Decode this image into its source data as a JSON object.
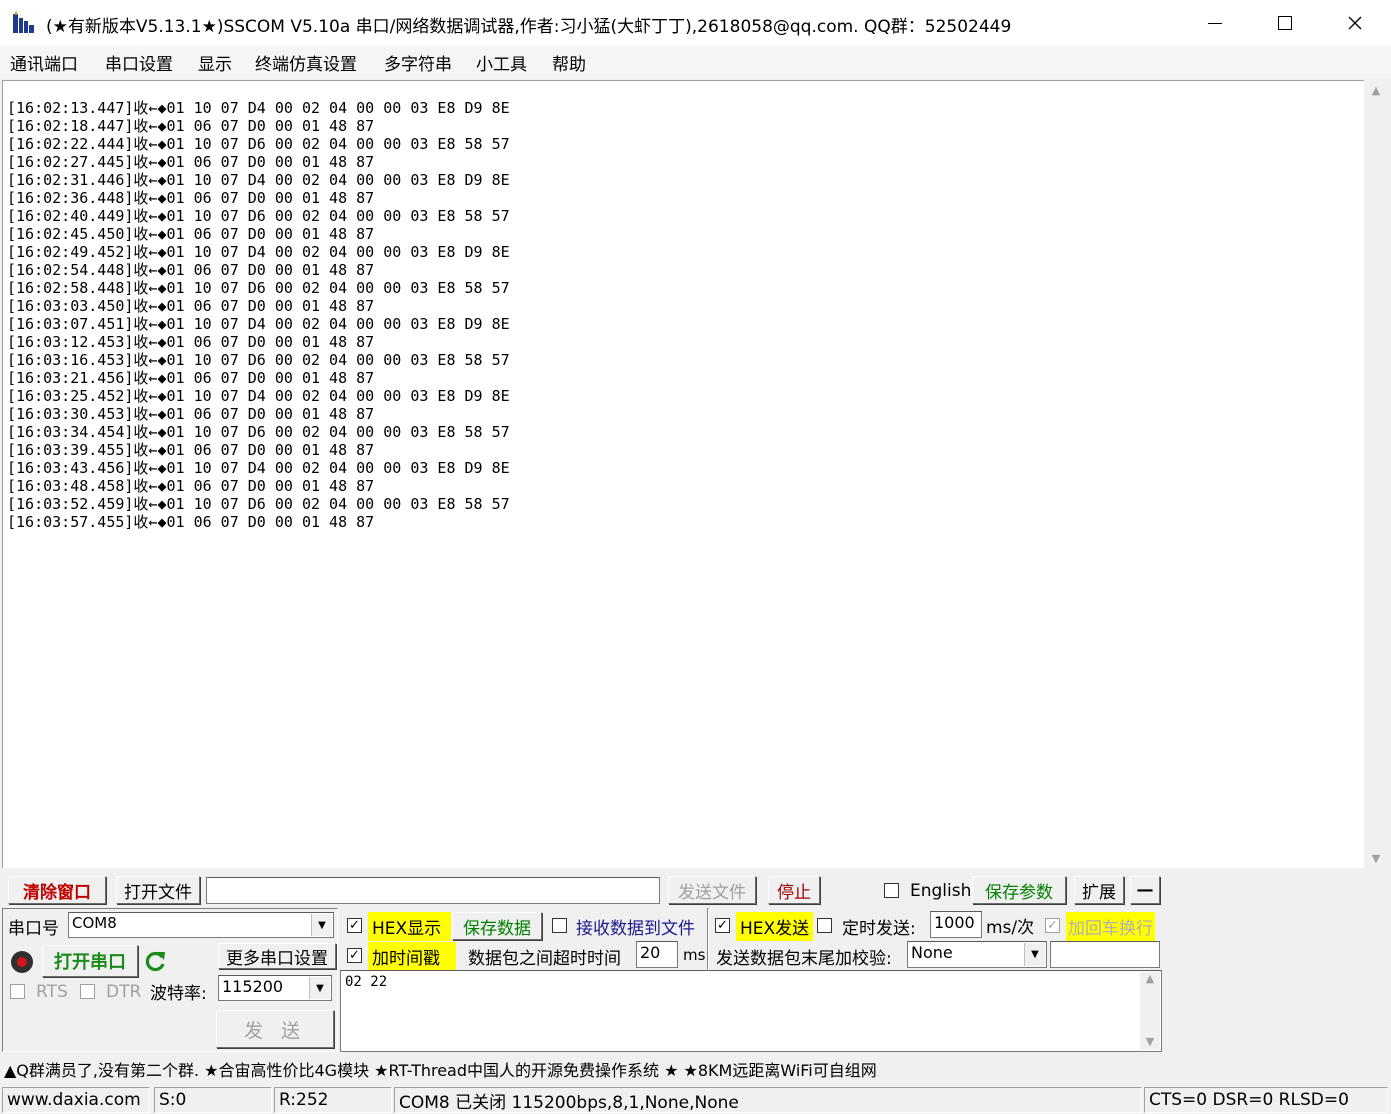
{
  "window": {
    "title": "(★有新版本V5.13.1★)SSCOM V5.10a 串口/网络数据调试器,作者:习小猛(大虾丁丁),2618058@qq.com. QQ群：52502449",
    "minimize_glyph": "—",
    "maximize_glyph": "☐",
    "close_glyph": "✕"
  },
  "menu": [
    "通讯端口",
    "串口设置",
    "显示",
    "终端仿真设置",
    "多字符串",
    "小工具",
    "帮助"
  ],
  "log": [
    "[16:02:13.447]收←◆01 10 07 D4 00 02 04 00 00 03 E8 D9 8E",
    "[16:02:18.447]收←◆01 06 07 D0 00 01 48 87",
    "[16:02:22.444]收←◆01 10 07 D6 00 02 04 00 00 03 E8 58 57",
    "[16:02:27.445]收←◆01 06 07 D0 00 01 48 87",
    "[16:02:31.446]收←◆01 10 07 D4 00 02 04 00 00 03 E8 D9 8E",
    "[16:02:36.448]收←◆01 06 07 D0 00 01 48 87",
    "[16:02:40.449]收←◆01 10 07 D6 00 02 04 00 00 03 E8 58 57",
    "[16:02:45.450]收←◆01 06 07 D0 00 01 48 87",
    "[16:02:49.452]收←◆01 10 07 D4 00 02 04 00 00 03 E8 D9 8E",
    "[16:02:54.448]收←◆01 06 07 D0 00 01 48 87",
    "[16:02:58.448]收←◆01 10 07 D6 00 02 04 00 00 03 E8 58 57",
    "[16:03:03.450]收←◆01 06 07 D0 00 01 48 87",
    "[16:03:07.451]收←◆01 10 07 D4 00 02 04 00 00 03 E8 D9 8E",
    "[16:03:12.453]收←◆01 06 07 D0 00 01 48 87",
    "[16:03:16.453]收←◆01 10 07 D6 00 02 04 00 00 03 E8 58 57",
    "[16:03:21.456]收←◆01 06 07 D0 00 01 48 87",
    "[16:03:25.452]收←◆01 10 07 D4 00 02 04 00 00 03 E8 D9 8E",
    "[16:03:30.453]收←◆01 06 07 D0 00 01 48 87",
    "[16:03:34.454]收←◆01 10 07 D6 00 02 04 00 00 03 E8 58 57",
    "[16:03:39.455]收←◆01 06 07 D0 00 01 48 87",
    "[16:03:43.456]收←◆01 10 07 D4 00 02 04 00 00 03 E8 D9 8E",
    "[16:03:48.458]收←◆01 06 07 D0 00 01 48 87",
    "[16:03:52.459]收←◆01 10 07 D6 00 02 04 00 00 03 E8 58 57",
    "[16:03:57.455]收←◆01 06 07 D0 00 01 48 87"
  ],
  "toolbar": {
    "clear_window": "清除窗口",
    "open_file": "打开文件",
    "file_path": "",
    "send_file": "发送文件",
    "stop": "停止",
    "english": "English",
    "save_params": "保存参数",
    "expand": "扩展",
    "collapse": "—"
  },
  "port": {
    "port_label": "串口号",
    "port_value": "COM8",
    "open_port": "打开串口",
    "more_settings": "更多串口设置",
    "rts": "RTS",
    "dtr": "DTR",
    "baud_label": "波特率:",
    "baud_value": "115200",
    "send": "发 送"
  },
  "options": {
    "hex_display": "HEX显示",
    "save_data": "保存数据",
    "recv_to_file": "接收数据到文件",
    "hex_send": "HEX发送",
    "timed_send": "定时发送:",
    "interval": "1000",
    "interval_unit": "ms/次",
    "add_crlf": "加回车换行",
    "add_timestamp": "加时间戳",
    "timeout_label": "数据包之间超时时间",
    "timeout_value": "20",
    "timeout_unit": "ms",
    "checksum_label": "发送数据包末尾加校验:",
    "checksum_value": "None",
    "checksum_extra": ""
  },
  "send_text": "02 22",
  "ad_line": "▲Q群满员了,没有第二个群. ★合宙高性价比4G模块 ★RT-Thread中国人的开源免费操作系统 ★ ★8KM远距离WiFi可自组网",
  "status": {
    "website": "www.daxia.com",
    "sent": "S:0",
    "received": "R:252",
    "port_state": "COM8 已关闭  115200bps,8,1,None,None",
    "lines": "CTS=0 DSR=0 RLSD=0"
  },
  "colors": {
    "highlight": "#ffff00",
    "red_label": "#c00000",
    "green_label": "#008000",
    "open_port_green": "#1a8a1a"
  }
}
